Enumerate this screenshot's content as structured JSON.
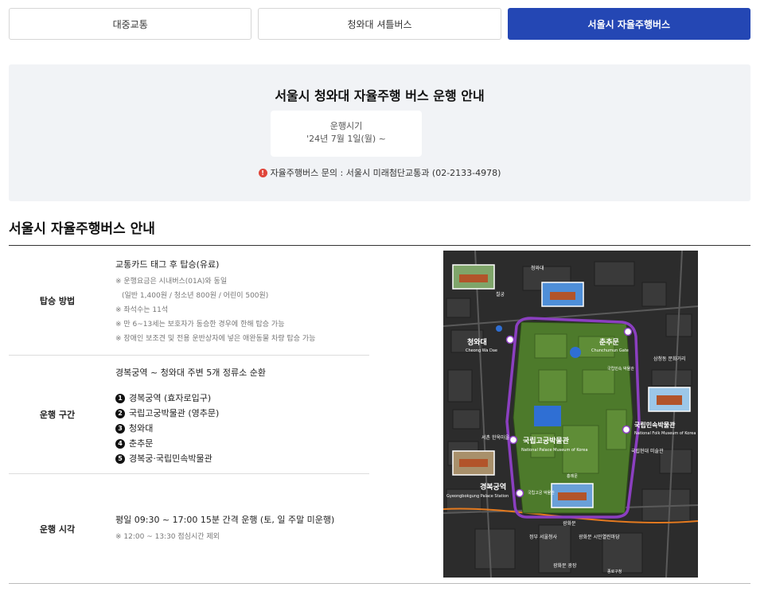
{
  "tabs": [
    {
      "label": "대중교통",
      "active": false
    },
    {
      "label": "청와대 셔틀버스",
      "active": false
    },
    {
      "label": "서울시 자율주행버스",
      "active": true
    }
  ],
  "notice": {
    "title": "서울시 청와대 자율주행 버스 운행 안내",
    "period_label": "운행시기",
    "period_value": "'24년 7월 1일(월) ~",
    "contact": "자율주행버스 문의 : 서울시 미래첨단교통과 (02-2133-4978)"
  },
  "section": {
    "title": "서울시 자율주행버스 안내"
  },
  "rows": {
    "boarding": {
      "head": "탑승 방법",
      "lead": "교통카드 태그 후 탑승(유료)",
      "notes": [
        "※ 운행요금은 시내버스(01A)와 동일",
        "(일반 1,400원 / 청소년 800원 / 어린이 500원)",
        "※ 좌석수는 11석",
        "※ 만 6~13세는 보호자가 동승한 경우에 한해 탑승 가능",
        "※ 장애인 보조견 및 전용 운반상자에 넣은 애완동물 차량 탑승 가능"
      ]
    },
    "route": {
      "head": "운행 구간",
      "lead": "경복궁역 ~ 청와대 주변 5개 정류소 순환",
      "stops": [
        {
          "num": "1",
          "name": "경복궁역 (효자로입구)"
        },
        {
          "num": "2",
          "name": "국립고궁박물관 (영추문)"
        },
        {
          "num": "3",
          "name": "청와대"
        },
        {
          "num": "4",
          "name": "춘추문"
        },
        {
          "num": "5",
          "name": "경복궁·국립민속박물관"
        }
      ]
    },
    "hours": {
      "head": "운행 시각",
      "lead": "평일 09:30 ~ 17:00 15분 간격 운행 (토, 일 주말 미운행)",
      "note": "※ 12:00 ~ 13:30 점심시간 제외"
    }
  },
  "map": {
    "labels": {
      "cheongwadae": "청와대",
      "cheongwadae_en": "Cheong Wa Dae",
      "chunchumun": "춘추문",
      "chunchumun_en": "Chunchumun Gate",
      "museum": "국립고궁박물관",
      "museum_en": "National Palace Museum of Korea",
      "folk": "국립민속박물관",
      "folk_en": "National Folk Museum of Korea",
      "gbstation": "경복궁역",
      "gbstation_en": "Gyeongbokgung Palace Station",
      "top_cheongwadae": "청와대",
      "chilgung": "칠궁",
      "samcheong": "삼청동 문화거리",
      "seochon": "서촌 한옥마을",
      "mmca": "국립현대 미술관",
      "gukrip_folk_small": "국립민속 박물관",
      "heungryemun": "흥례문",
      "palace_museum_small": "국립고궁 박물관",
      "gwanghwamun": "광화문",
      "gov": "정부 서울청사",
      "gwanghwamun_sq": "광화문 시민열린마당",
      "plaza": "광화문 광장",
      "jongno": "종로구청"
    },
    "colors": {
      "route": "#8b3fc0",
      "palace": "#4d7a2b",
      "pond": "#2f6fd4",
      "background": "#2c2c2c"
    }
  }
}
